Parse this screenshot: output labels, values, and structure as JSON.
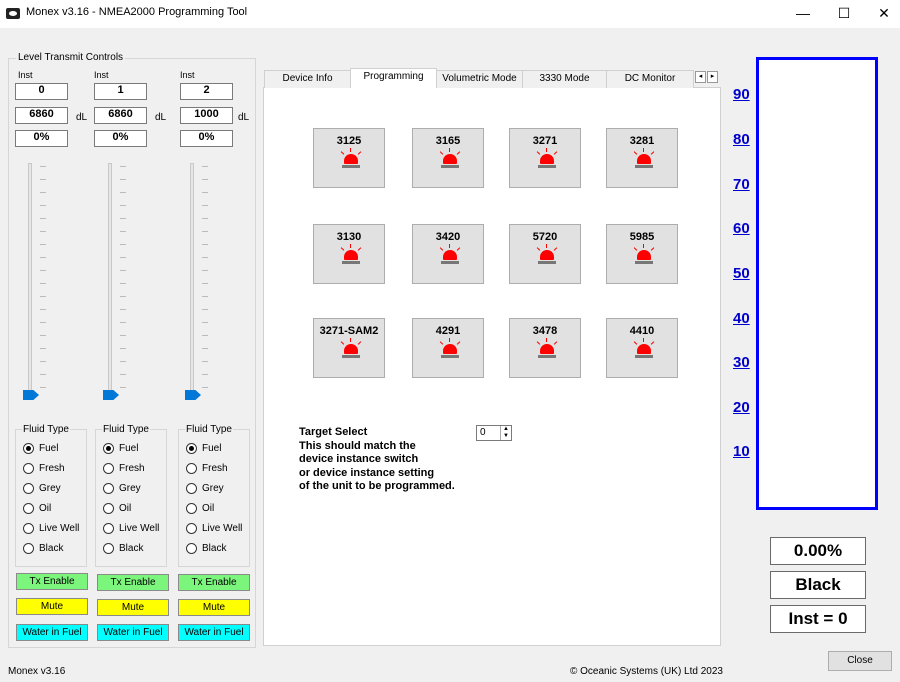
{
  "window": {
    "title": "Monex v3.16 - NMEA2000 Programming Tool",
    "minimize": "—",
    "maximize": "☐",
    "close": "✕"
  },
  "level_controls": {
    "group_title": "Level Transmit Controls",
    "channels": [
      {
        "inst_label": "Inst",
        "inst": "0",
        "capacity": "6860",
        "unit": "dL",
        "percent": "0%",
        "level": 0
      },
      {
        "inst_label": "Inst",
        "inst": "1",
        "capacity": "6860",
        "unit": "dL",
        "percent": "0%",
        "level": 0
      },
      {
        "inst_label": "Inst",
        "inst": "2",
        "capacity": "1000",
        "unit": "dL",
        "percent": "0%",
        "level": 0
      }
    ],
    "fluid_type_title": "Fluid Type",
    "fluid_options": [
      "Fuel",
      "Fresh",
      "Grey",
      "Oil",
      "Live Well",
      "Black"
    ],
    "selected_fluid": "Fuel",
    "tx_enable": "Tx Enable",
    "mute": "Mute",
    "water_in_fuel": "Water in Fuel"
  },
  "tabs": [
    "Device Info",
    "Programming",
    "Volumetric Mode",
    "3330 Mode",
    "DC Monitor"
  ],
  "active_tab": "Programming",
  "tab_scroll": {
    "left": "◂",
    "right": "▸"
  },
  "devices": [
    "3125",
    "3165",
    "3271",
    "3281",
    "3130",
    "3420",
    "5720",
    "5985",
    "3271-SAM2",
    "4291",
    "3478",
    "4410"
  ],
  "target": {
    "lines": [
      "Target Select",
      "This should match the",
      "device instance switch",
      "or device instance setting",
      "of the unit to be programmed."
    ],
    "value": "0",
    "up": "▲",
    "down": "▼"
  },
  "gauge": {
    "scale": [
      "90",
      "80",
      "70",
      "60",
      "50",
      "40",
      "30",
      "20",
      "10"
    ],
    "percent": "0.00%",
    "fluid": "Black",
    "inst": "Inst = 0",
    "color": "#0000ff"
  },
  "close_button": "Close",
  "status": {
    "version": "Monex v3.16",
    "copyright": "© Oceanic Systems (UK) Ltd 2023"
  }
}
